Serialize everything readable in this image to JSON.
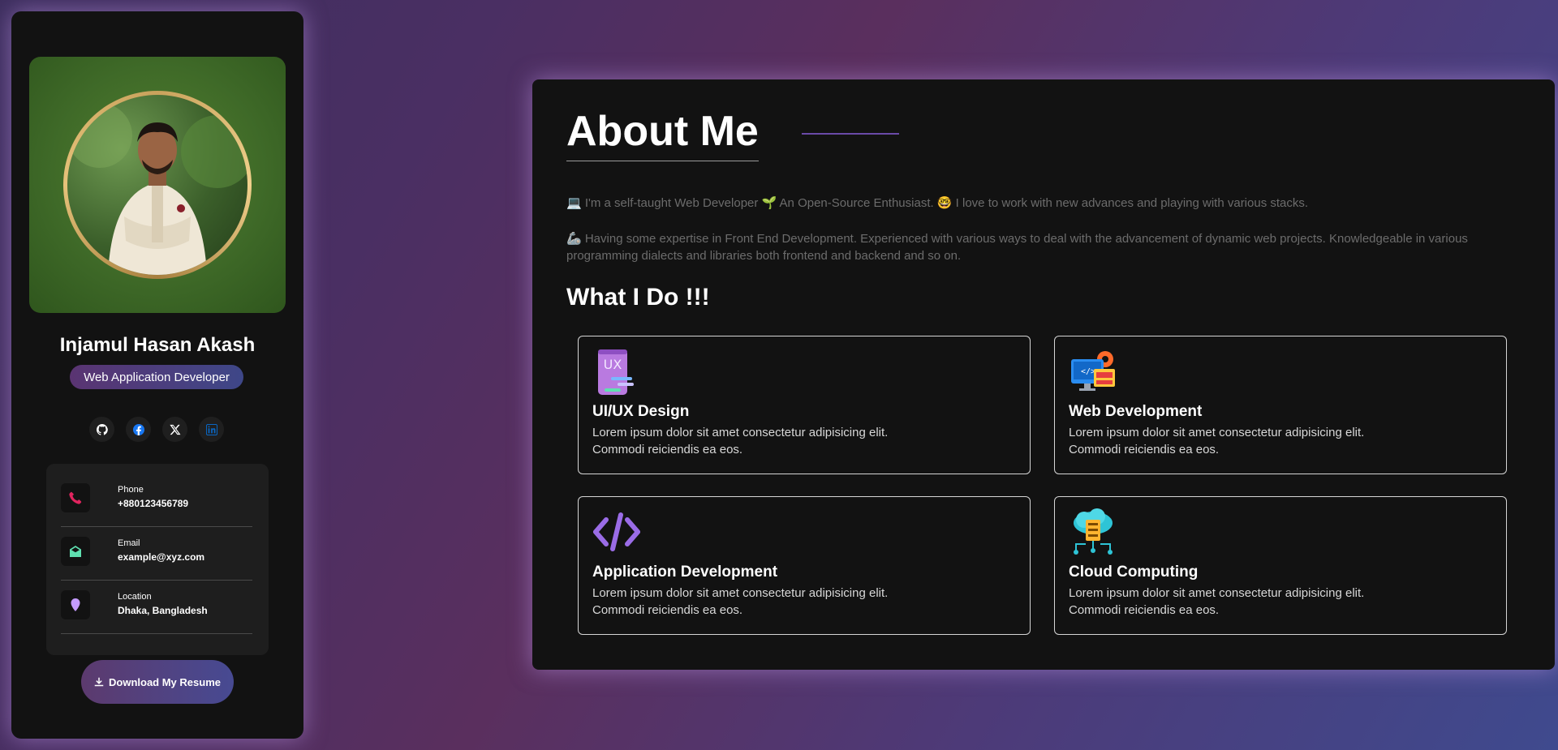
{
  "profile": {
    "name": "Injamul Hasan Akash",
    "role": "Web Application Developer"
  },
  "socials": [
    {
      "icon": "github-icon",
      "color": "#ffffff"
    },
    {
      "icon": "facebook-icon",
      "color": "#1877f2"
    },
    {
      "icon": "x-icon",
      "color": "#ffffff"
    },
    {
      "icon": "linkedin-icon",
      "color": "#0a66c2"
    }
  ],
  "contacts": {
    "phone": {
      "label": "Phone",
      "value": "+880123456789",
      "icon": "phone-icon",
      "color": "#e0245e"
    },
    "email": {
      "label": "Email",
      "value": "example@xyz.com",
      "icon": "envelope-open-icon",
      "color": "#5fe0b0"
    },
    "location": {
      "label": "Location",
      "value": "Dhaka, Bangladesh",
      "icon": "location-pin-icon",
      "color": "#c49bff"
    }
  },
  "download": {
    "label": "Download My Resume",
    "icon": "download-icon"
  },
  "about": {
    "title": "About Me",
    "para1": "💻 I'm a self-taught Web Developer 🌱 An Open-Source Enthusiast. 🤓 I love to work with new advances and playing with various stacks.",
    "para2": "🦾 Having some expertise in Front End Development. Experienced with various ways to deal with the advancement of dynamic web projects. Knowledgeable in various programming dialects and libraries both frontend and backend and so on."
  },
  "what_i_do": {
    "title": "What I Do !!!",
    "services": [
      {
        "title": "UI/UX Design",
        "desc": "Lorem ipsum dolor sit amet consectetur adipisicing elit. Commodi reiciendis ea eos.",
        "icon": "ux-design-icon"
      },
      {
        "title": "Web Development",
        "desc": "Lorem ipsum dolor sit amet consectetur adipisicing elit. Commodi reiciendis ea eos.",
        "icon": "web-development-icon"
      },
      {
        "title": "Application Development",
        "desc": "Lorem ipsum dolor sit amet consectetur adipisicing elit. Commodi reiciendis ea eos.",
        "icon": "code-icon"
      },
      {
        "title": "Cloud Computing",
        "desc": "Lorem ipsum dolor sit amet consectetur adipisicing elit. Commodi reiciendis ea eos.",
        "icon": "cloud-server-icon"
      }
    ]
  },
  "colors": {
    "accent_purple": "#6a4aa8",
    "card_bg": "#121212",
    "muted_text": "#6c6c6c"
  }
}
